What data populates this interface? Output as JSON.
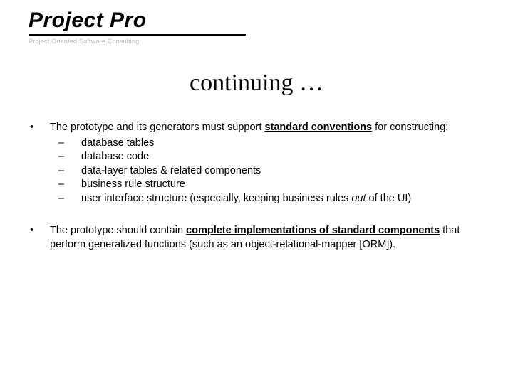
{
  "logo": {
    "main": "Project Pro",
    "tagline": "Project Oriented Software Consulting"
  },
  "title": "continuing …",
  "bullets": [
    {
      "marker": "•",
      "lead_pre": "The prototype and its generators must support ",
      "lead_bold_u": "standard conventions",
      "lead_post": " for constructing:",
      "subs": [
        {
          "dash": "–",
          "text": "database tables"
        },
        {
          "dash": "–",
          "text": "database code"
        },
        {
          "dash": "–",
          "text": "data-layer tables & related components"
        },
        {
          "dash": "–",
          "text": "business rule structure"
        },
        {
          "dash": "–",
          "text_pre": "user interface structure (especially, keeping business rules ",
          "text_ital": "out",
          "text_post": " of the UI)"
        }
      ]
    },
    {
      "marker": "•",
      "lead_pre": "The prototype should contain ",
      "lead_bold_u": "complete implementations of standard components",
      "lead_post": " that perform generalized functions (such as an object-relational-mapper [ORM])."
    }
  ]
}
